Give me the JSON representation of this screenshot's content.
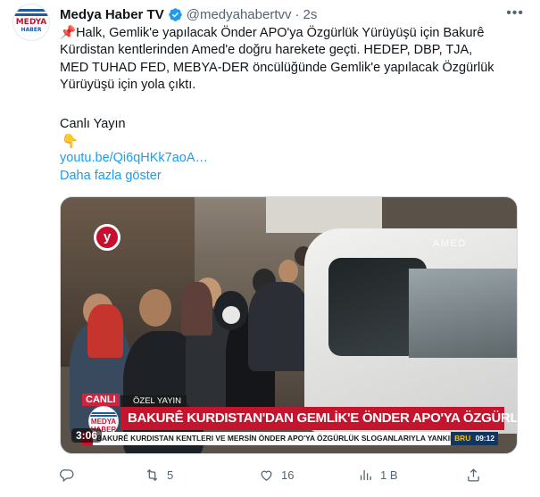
{
  "account": {
    "name": "Medya Haber TV",
    "handle": "@medyahabertvv",
    "separator": "·",
    "time": "2s",
    "avatar_text_top": "MEDYA",
    "avatar_text_bottom": "HABER"
  },
  "tweet": {
    "pin_icon": "📌",
    "line1": "Halk, Gemlik'e yapılacak Önder APO'ya Özgürlük Yürüyüşü için Bakurê",
    "line2": "Kürdistan kentlerinden Amed'e doğru harekete geçti. HEDEP, DBP, TJA,",
    "line3": "MED TUHAD FED, MEBYA-DER öncülüğünde Gemlik'e yapılacak Özgürlük",
    "line4": "Yürüyüşü için yola çıktı.",
    "live": "Canlı Yayın",
    "hand_icon": "👇",
    "link": "youtu.be/Qi6qHKk7aoA…",
    "show_more": "Daha fazla göster"
  },
  "video": {
    "channel_logo": "y",
    "location": "AMED",
    "canli": "CANLI",
    "ozel": "ÖZEL YAYIN",
    "logo_text": "MEDYA HABER",
    "headline": "BAKURÊ KURDISTAN'DAN GEMLİK'E ÖNDER APO'YA ÖZGÜRLÜK YÜRÜYÜŞÜ",
    "ticker": "BAKURÊ KURDISTAN KENTLERI VE MERSİN ÖNDER APO'YA ÖZGÜRLÜK SLOGANLARIYLA YANKILANDI",
    "ticker_city": "BRU",
    "ticker_time": "09:12",
    "duration": "3:06"
  },
  "actions": {
    "replies": "",
    "retweets": "5",
    "likes": "16",
    "views": "1 B"
  },
  "colors": {
    "accent": "#1d9bf0",
    "text": "#0f1419",
    "muted": "#536471",
    "brand_red": "#c3162e"
  },
  "icons": [
    "verified-badge-icon",
    "more-icon",
    "reply-icon",
    "retweet-icon",
    "like-icon",
    "views-icon",
    "share-icon"
  ]
}
